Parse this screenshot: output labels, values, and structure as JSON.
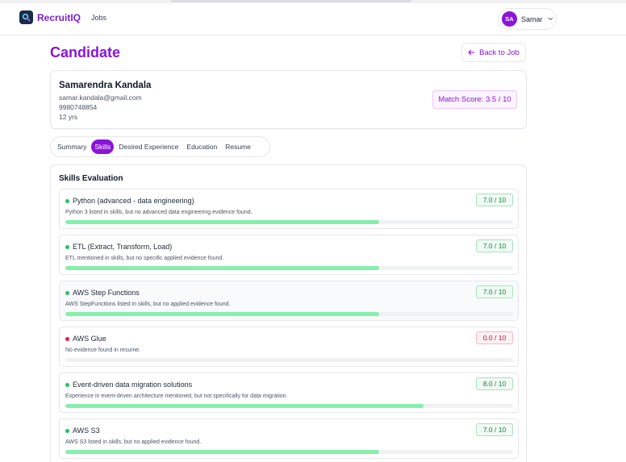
{
  "header": {
    "brand": "RecruitIQ",
    "nav_jobs": "Jobs",
    "user_initials": "SA",
    "user_name": "Samar"
  },
  "page": {
    "title": "Candidate",
    "back_label": "Back to Job"
  },
  "candidate": {
    "name": "Samarendra Kandala",
    "email": "samar.kandala@gmail.com",
    "phone": "9980748854",
    "experience": "12 yrs",
    "match_score": "Match Score: 3.5 / 10"
  },
  "tabs": [
    "Summary",
    "Skills",
    "Desired Experience",
    "Education",
    "Resume"
  ],
  "active_tab": "Skills",
  "skills_section": {
    "title": "Skills Evaluation",
    "skills": [
      {
        "name": "Python (advanced - data engineering)",
        "note": "Python 3 listed in skills, but no advanced data engineering evidence found.",
        "score_label": "7.0 / 10",
        "score": 7.0,
        "status": "ok"
      },
      {
        "name": "ETL (Extract, Transform, Load)",
        "note": "ETL mentioned in skills, but no specific applied evidence found.",
        "score_label": "7.0 / 10",
        "score": 7.0,
        "status": "ok"
      },
      {
        "name": "AWS Step Functions",
        "note": "AWS StepFunctions listed in skills, but no applied evidence found.",
        "score_label": "7.0 / 10",
        "score": 7.0,
        "status": "ok"
      },
      {
        "name": "AWS Glue",
        "note": "No evidence found in resume.",
        "score_label": "0.0 / 10",
        "score": 0.0,
        "status": "bad"
      },
      {
        "name": "Event-driven data migration solutions",
        "note": "Experience in event-driven architecture mentioned, but not specifically for data migration.",
        "score_label": "8.0 / 10",
        "score": 8.0,
        "status": "ok"
      },
      {
        "name": "AWS S3",
        "note": "AWS S3 listed in skills, but no applied evidence found.",
        "score_label": "7.0 / 10",
        "score": 7.0,
        "status": "ok"
      }
    ]
  },
  "colors": {
    "brand": "#8b14d9",
    "dot_ok": "#22c55e",
    "dot_bad": "#e11d48",
    "bar_fill": "#86efac"
  }
}
